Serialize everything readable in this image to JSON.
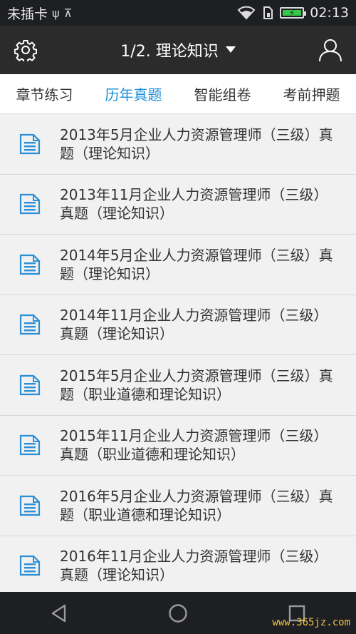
{
  "status_bar": {
    "carrier": "未插卡",
    "usb_symbol": "ψ",
    "android_symbol": "⊼",
    "time": "02:13"
  },
  "app_bar": {
    "title": "1/2. 理论知识"
  },
  "tabs": [
    {
      "label": "章节练习",
      "active": false
    },
    {
      "label": "历年真题",
      "active": true
    },
    {
      "label": "智能组卷",
      "active": false
    },
    {
      "label": "考前押题",
      "active": false
    }
  ],
  "papers": [
    {
      "title": "2013年5月企业人力资源管理师（三级）真题（理论知识）"
    },
    {
      "title": "2013年11月企业人力资源管理师（三级）真题（理论知识）"
    },
    {
      "title": "2014年5月企业人力资源管理师（三级）真题（理论知识）"
    },
    {
      "title": "2014年11月企业人力资源管理师（三级）真题（理论知识）"
    },
    {
      "title": "2015年5月企业人力资源管理师（三级）真题（职业道德和理论知识）"
    },
    {
      "title": "2015年11月企业人力资源管理师（三级）真题（职业道德和理论知识）"
    },
    {
      "title": "2016年5月企业人力资源管理师（三级）真题（职业道德和理论知识）"
    },
    {
      "title": "2016年11月企业人力资源管理师（三级）真题（理论知识）"
    }
  ],
  "watermark": "www.365jz.com",
  "colors": {
    "accent": "#1a8fd8",
    "doc_icon": "#2a8fd6",
    "app_bar_bg": "#2b2b2b",
    "list_bg": "#f1f1f1"
  },
  "icons": {
    "settings": "gear-icon",
    "dropdown": "caret-down-icon",
    "account": "user-icon",
    "list_item": "document-icon",
    "nav_back": "triangle-back-icon",
    "nav_home": "circle-home-icon",
    "nav_recents": "square-recents-icon"
  }
}
